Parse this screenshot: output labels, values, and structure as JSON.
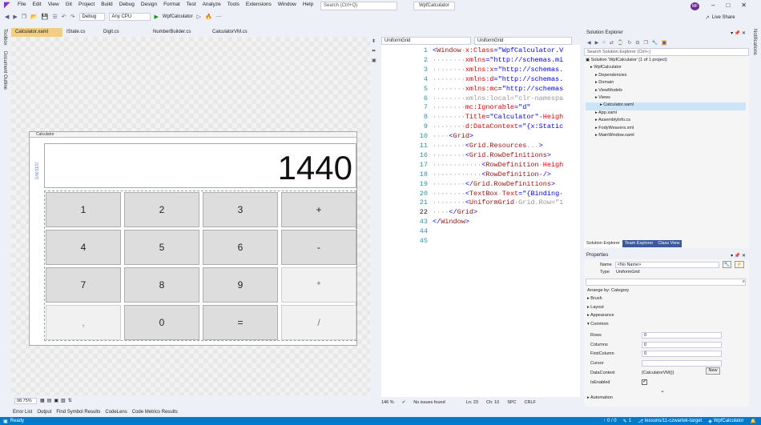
{
  "menu": [
    "File",
    "Edit",
    "View",
    "Git",
    "Project",
    "Build",
    "Debug",
    "Design",
    "Format",
    "Test",
    "Analyze",
    "Tools",
    "Extensions",
    "Window",
    "Help"
  ],
  "search_placeholder": "Search (Ctrl+Q)",
  "app_title": "WpfCalculator",
  "avatar_initials": "MF",
  "toolbar": {
    "config": "Debug",
    "platform": "Any CPU",
    "start_label": "WpfCalculator",
    "live_share": "Live Share"
  },
  "left_strip": {
    "toolbox": "Toolbox",
    "outline": "Document Outline"
  },
  "right_strip": {
    "notifications": "Notifications"
  },
  "doc_tabs": [
    "Calculator.xaml",
    "IState.cs",
    "Digit.cs",
    "NumberBuilder.cs",
    "CalculatorVM.cs"
  ],
  "calculator": {
    "window_title": "Calculator",
    "display_value": "1440",
    "height_label": "(133.067)",
    "keys": [
      "1",
      "2",
      "3",
      "+",
      "4",
      "5",
      "6",
      "-",
      "7",
      "8",
      "9",
      "*",
      ",",
      "0",
      "=",
      "/"
    ]
  },
  "designer_status": {
    "zoom": "98.75%"
  },
  "xaml_header": {
    "left": "UniformGrid",
    "right": "UniformGrid"
  },
  "code": {
    "line_numbers": [
      "1",
      "2",
      "3",
      "4",
      "5",
      "6",
      "7",
      "8",
      "9",
      "10",
      "11",
      "16",
      "17",
      "18",
      "19",
      "20",
      "21",
      "22",
      "43",
      "44",
      "45"
    ],
    "lines": [
      [
        {
          "t": "<",
          "c": "cb"
        },
        {
          "t": "Window",
          "c": "ce"
        },
        {
          "t": "·",
          "c": "cg"
        },
        {
          "t": "x:Class",
          "c": "ca"
        },
        {
          "t": "=\"WpfCalculator.V",
          "c": "cs"
        }
      ],
      [
        {
          "t": "········",
          "c": "cg"
        },
        {
          "t": "xmlns",
          "c": "ca"
        },
        {
          "t": "=\"http://schemas.mi",
          "c": "cs"
        }
      ],
      [
        {
          "t": "········",
          "c": "cg"
        },
        {
          "t": "xmlns:x",
          "c": "ca"
        },
        {
          "t": "=\"http://schemas.",
          "c": "cs"
        }
      ],
      [
        {
          "t": "········",
          "c": "cg"
        },
        {
          "t": "xmlns:d",
          "c": "ca"
        },
        {
          "t": "=\"http://schemas.",
          "c": "cs"
        }
      ],
      [
        {
          "t": "········",
          "c": "cg"
        },
        {
          "t": "xmlns:mc",
          "c": "ca"
        },
        {
          "t": "=\"http://schemas",
          "c": "cs"
        }
      ],
      [
        {
          "t": "········",
          "c": "cg"
        },
        {
          "t": "xmlns:local",
          "c": "cg"
        },
        {
          "t": "=\"clr-namespa",
          "c": "cg"
        }
      ],
      [
        {
          "t": "········",
          "c": "cg"
        },
        {
          "t": "mc:Ignorable",
          "c": "ca"
        },
        {
          "t": "=\"d\"",
          "c": "cs"
        }
      ],
      [
        {
          "t": "········",
          "c": "cg"
        },
        {
          "t": "Title",
          "c": "ca"
        },
        {
          "t": "=\"Calculator\"·",
          "c": "cs"
        },
        {
          "t": "Heigh",
          "c": "ca"
        }
      ],
      [
        {
          "t": "········",
          "c": "cg"
        },
        {
          "t": "d:DataContext",
          "c": "ca"
        },
        {
          "t": "=\"{x:Static",
          "c": "cs"
        }
      ],
      [
        {
          "t": "····",
          "c": "cg"
        },
        {
          "t": "<",
          "c": "cb"
        },
        {
          "t": "Grid",
          "c": "ce"
        },
        {
          "t": ">",
          "c": "cb"
        }
      ],
      [
        {
          "t": "········",
          "c": "cg"
        },
        {
          "t": "<",
          "c": "cb"
        },
        {
          "t": "Grid.Resources",
          "c": "ce"
        },
        {
          "t": "...",
          "c": "cg"
        },
        {
          "t": ">",
          "c": "cb"
        }
      ],
      [
        {
          "t": "········",
          "c": "cg"
        },
        {
          "t": "<",
          "c": "cb"
        },
        {
          "t": "Grid.RowDefinitions",
          "c": "ce"
        },
        {
          "t": ">",
          "c": "cb"
        }
      ],
      [
        {
          "t": "············",
          "c": "cg"
        },
        {
          "t": "<",
          "c": "cb"
        },
        {
          "t": "RowDefinition",
          "c": "ce"
        },
        {
          "t": "·",
          "c": "cg"
        },
        {
          "t": "Heigh",
          "c": "ca"
        }
      ],
      [
        {
          "t": "············",
          "c": "cg"
        },
        {
          "t": "<",
          "c": "cb"
        },
        {
          "t": "RowDefinition",
          "c": "ce"
        },
        {
          "t": "·/>",
          "c": "cb"
        }
      ],
      [
        {
          "t": "········",
          "c": "cg"
        },
        {
          "t": "</",
          "c": "cb"
        },
        {
          "t": "Grid.RowDefinitions",
          "c": "ce"
        },
        {
          "t": ">",
          "c": "cb"
        }
      ],
      [
        {
          "t": "········",
          "c": "cg"
        },
        {
          "t": "<",
          "c": "cb"
        },
        {
          "t": "TextBox",
          "c": "ce"
        },
        {
          "t": "·",
          "c": "cg"
        },
        {
          "t": "Text",
          "c": "ca"
        },
        {
          "t": "=\"{Binding·",
          "c": "cs"
        }
      ],
      [
        {
          "t": "········",
          "c": "cg"
        },
        {
          "t": "<",
          "c": "cb"
        },
        {
          "t": "UniformGrid",
          "c": "ce"
        },
        {
          "t": "·",
          "c": "cg"
        },
        {
          "t": "Grid.Row=\"1",
          "c": "cg"
        }
      ],
      [
        {
          "t": "····",
          "c": "cg"
        },
        {
          "t": "</",
          "c": "cb"
        },
        {
          "t": "Grid",
          "c": "ce"
        },
        {
          "t": ">",
          "c": "cb"
        }
      ],
      [
        {
          "t": "</",
          "c": "cb"
        },
        {
          "t": "Window",
          "c": "ce"
        },
        {
          "t": ">",
          "c": "cb"
        }
      ],
      [],
      []
    ]
  },
  "editor_status": {
    "zoom": "146 %",
    "issues": "No issues found",
    "ln": "Ln: 23",
    "ch": "Ch: 10",
    "spc": "SPC",
    "crlf": "CRLF"
  },
  "solution_explorer": {
    "title": "Solution Explorer",
    "search_placeholder": "Search Solution Explorer (Ctrl+;)",
    "tree": [
      {
        "label": "Solution 'WpfCalculator' (1 of 1 project)",
        "indent": 0,
        "selected": false
      },
      {
        "label": "WpfCalculator",
        "indent": 1,
        "selected": false
      },
      {
        "label": "Dependencies",
        "indent": 2,
        "selected": false
      },
      {
        "label": "Domain",
        "indent": 2,
        "selected": false
      },
      {
        "label": "ViewModels",
        "indent": 2,
        "selected": false
      },
      {
        "label": "Views",
        "indent": 2,
        "selected": false
      },
      {
        "label": "Calculator.xaml",
        "indent": 3,
        "selected": true
      },
      {
        "label": "App.xaml",
        "indent": 2,
        "selected": false
      },
      {
        "label": "AssemblyInfo.cs",
        "indent": 2,
        "selected": false
      },
      {
        "label": "FodyWeavers.xml",
        "indent": 2,
        "selected": false
      },
      {
        "label": "MainWindow.xaml",
        "indent": 2,
        "selected": false
      }
    ],
    "tabs": [
      "Solution Explorer",
      "Team Explorer",
      "Class View"
    ]
  },
  "properties": {
    "title": "Properties",
    "name_label": "Name",
    "name_value": "<No Name>",
    "type_label": "Type",
    "type_value": "UniformGrid",
    "arrange": "Arrange by: Category",
    "categories": [
      "Brush",
      "Layout",
      "Appearance",
      "Common"
    ],
    "fields": [
      {
        "label": "Rows",
        "value": "0"
      },
      {
        "label": "Columns",
        "value": "0"
      },
      {
        "label": "FirstColumn",
        "value": "0"
      },
      {
        "label": "Cursor",
        "value": ""
      },
      {
        "label": "DataContext",
        "value": "{CalculatorVM()}"
      },
      {
        "label": "IsEnabled",
        "value": ""
      }
    ],
    "new_button": "New",
    "footer_category": "Automation"
  },
  "bottom_tabs": [
    "Error List",
    "Output",
    "Find Symbol Results",
    "CodeLens",
    "Code Metrics Results"
  ],
  "statusbar": {
    "ready": "Ready",
    "up": "0 / 0",
    "pencil": "1",
    "branch": "lessons/11-czwartek-target",
    "repo": "WpfCalculator"
  }
}
